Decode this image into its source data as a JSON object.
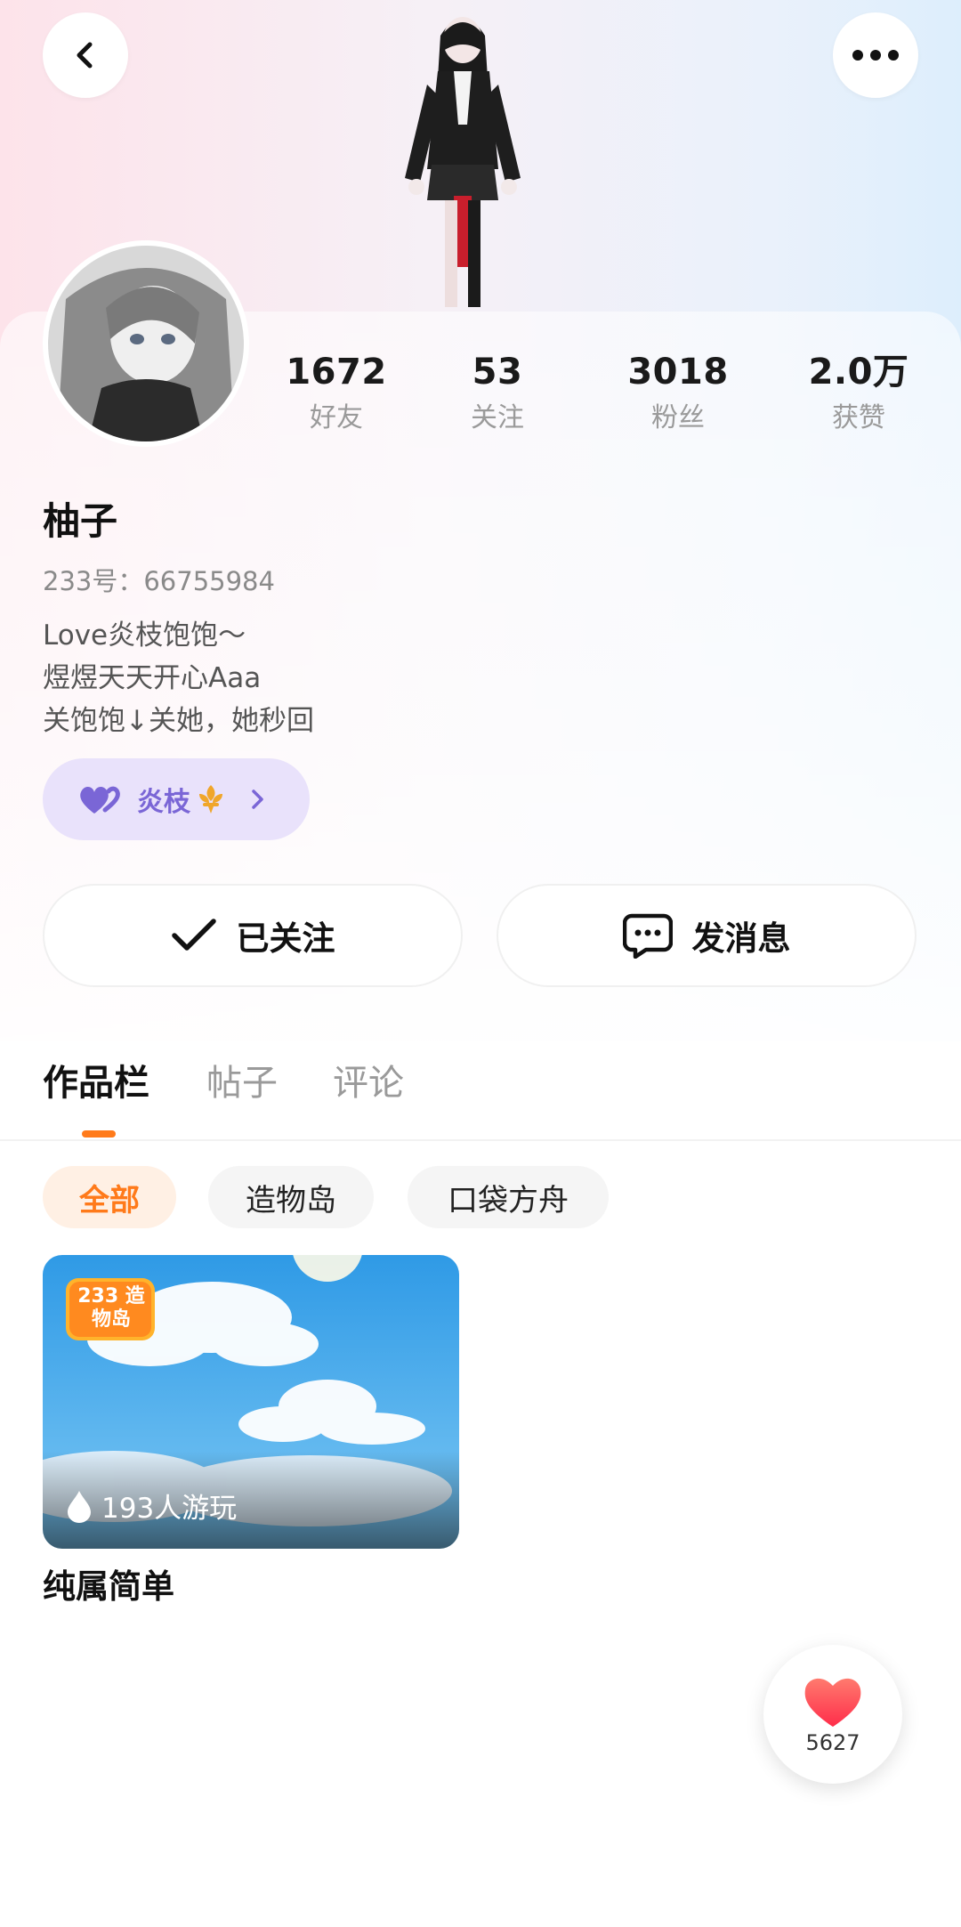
{
  "profile": {
    "name": "柚子",
    "uid": "233号：66755984",
    "bio": [
      "Love炎枝饱饱～",
      "煜煜天天开心Aaa",
      "关饱饱↓关她，她秒回"
    ]
  },
  "stats": [
    {
      "value": "1672",
      "label": "好友"
    },
    {
      "value": "53",
      "label": "关注"
    },
    {
      "value": "3018",
      "label": "粉丝"
    },
    {
      "value": "2.0万",
      "label": "获赞"
    }
  ],
  "group_chip": {
    "label": "炎枝"
  },
  "actions": {
    "follow": "已关注",
    "message": "发消息"
  },
  "tabs": [
    {
      "label": "作品栏",
      "active": true
    },
    {
      "label": "帖子",
      "active": false
    },
    {
      "label": "评论",
      "active": false
    }
  ],
  "filters": [
    {
      "label": "全部",
      "active": true
    },
    {
      "label": "造物岛",
      "active": false
    },
    {
      "label": "口袋方舟",
      "active": false
    }
  ],
  "works": [
    {
      "title": "纯属简单",
      "plays": "193人游玩",
      "logo_text": "233 造物岛"
    }
  ],
  "like_button": {
    "count": "5627"
  },
  "colors": {
    "accent": "#ff7a1a",
    "group_purple": "#7a66d6",
    "heart_red": "#ff4d4d"
  }
}
